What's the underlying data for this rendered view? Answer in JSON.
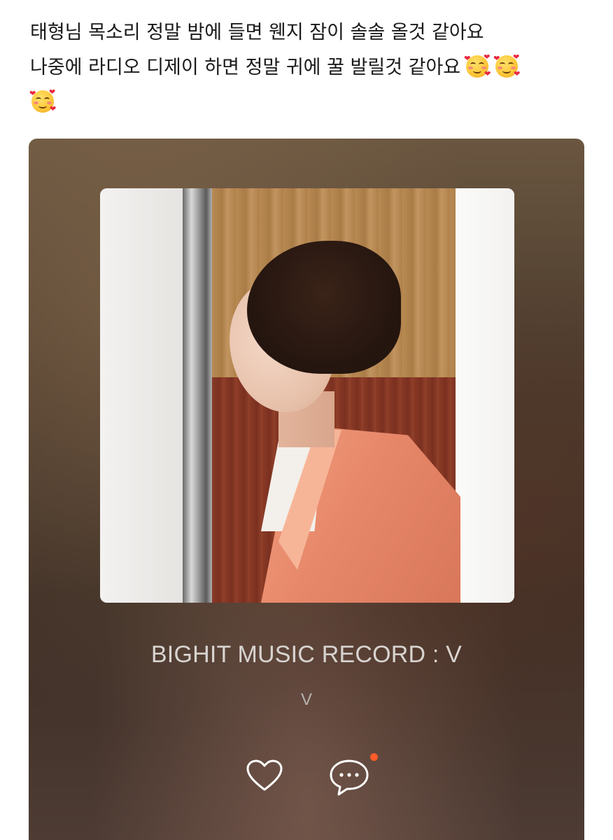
{
  "post": {
    "line1": "태형님 목소리 정말 밤에 들면 웬지 잠이 솔솔 올것 같아요",
    "line2": "나중에 라디오 디제이 하면 정말 귀에 꿀 발릴것 같아요",
    "emoji_name": "smiling-face-with-hearts"
  },
  "player": {
    "title": "BIGHIT MUSIC RECORD : V",
    "artist": "V",
    "icons": {
      "like": "heart-outline-icon",
      "comments": "comment-bubble-icon"
    },
    "notification_dot_color": "#ff5a2a"
  }
}
